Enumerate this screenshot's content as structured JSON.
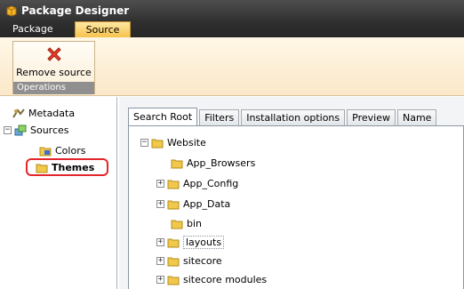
{
  "app": {
    "title": "Package Designer"
  },
  "tabs": [
    "Package",
    "Source"
  ],
  "ribbon": {
    "remove_source_label": "Remove source",
    "group_label": "Operations"
  },
  "left_tree": {
    "metadata": "Metadata",
    "sources": "Sources",
    "colors": "Colors",
    "themes": "Themes"
  },
  "panel_tabs": [
    "Search Root",
    "Filters",
    "Installation options",
    "Preview",
    "Name"
  ],
  "active_panel_tab": "Search Root",
  "folder_tree": {
    "root": "Website",
    "children": [
      "App_Browsers",
      "App_Config",
      "App_Data",
      "bin",
      "layouts",
      "sitecore",
      "sitecore modules"
    ]
  },
  "colors": {
    "header": "#2f2f2f",
    "active_tab": "#f7c34c",
    "highlight": "#e3262b",
    "folder": "#f2c84b"
  },
  "icons": [
    "package-icon",
    "remove-x-icon",
    "metadata-icon",
    "sources-icon",
    "colors-icon",
    "folder-icon"
  ]
}
